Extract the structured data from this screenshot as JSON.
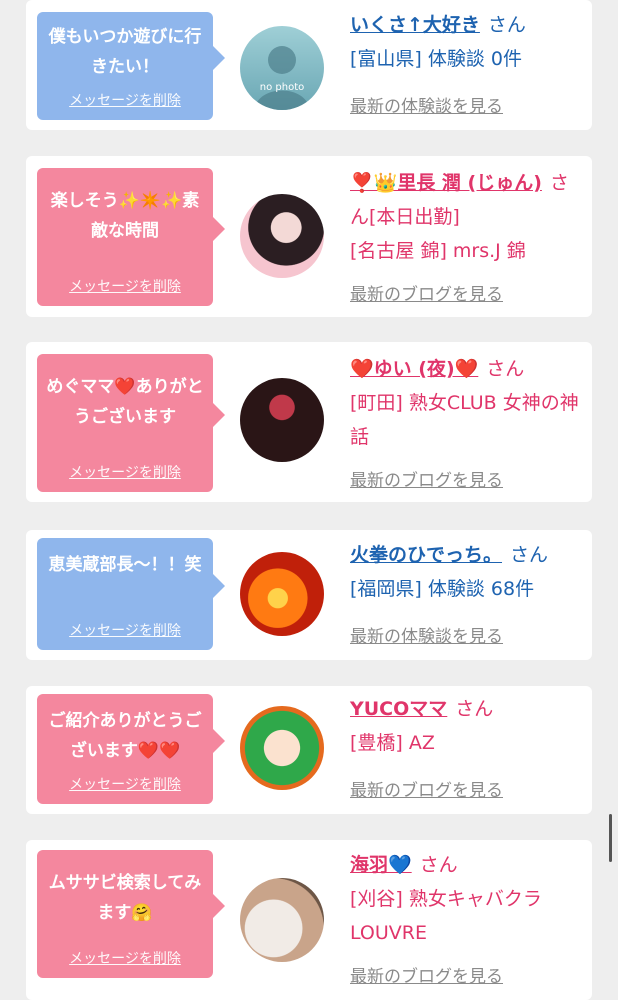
{
  "messages": [
    {
      "bubble_text": "僕もいつか遊びに行きたい！",
      "delete_label": "メッセージを削除",
      "name": "いくさ↑大好き",
      "honorific": "さん",
      "meta": "[富山県] 体験談 0件",
      "see_more": "最新の体験談を見る",
      "avatar_icon": "no-photo-avatar",
      "avatar_text": "no photo"
    },
    {
      "bubble_text": "楽しそう✨✴️✨素敵な時間",
      "delete_label": "メッセージを削除",
      "name": "❣️👑里長 潤 (じゅん)",
      "honorific": "さん",
      "meta_inline": "[本日出勤]",
      "meta": "[名古屋 錦] mrs.J 錦",
      "see_more": "最新のブログを見る",
      "avatar_icon": "user-photo-avatar"
    },
    {
      "bubble_text": "めぐママ❤️ありがとうございます",
      "delete_label": "メッセージを削除",
      "name": "❤️ゆい (夜)❤️",
      "honorific": "さん",
      "meta": "[町田] 熟女CLUB 女神の神話",
      "see_more": "最新のブログを見る",
      "avatar_icon": "user-photo-avatar"
    },
    {
      "bubble_text": "恵美蔵部長〜！！笑",
      "delete_label": "メッセージを削除",
      "name": "火拳のひでっち。",
      "honorific": "さん",
      "meta": "[福岡県] 体験談 68件",
      "see_more": "最新の体験談を見る",
      "avatar_icon": "fire-avatar"
    },
    {
      "bubble_text": "ご紹介ありがとうございます❤️❤️",
      "delete_label": "メッセージを削除",
      "name": "YUCOママ",
      "honorific": "さん",
      "meta": "[豊橋] AZ",
      "see_more": "最新のブログを見る",
      "avatar_icon": "illustration-avatar"
    },
    {
      "bubble_text": "ムササビ検索してみます🤗",
      "delete_label": "メッセージを削除",
      "name": "海羽💙",
      "honorific": "さん",
      "meta": "[刈谷] 熟女キャバクラLOUVRE",
      "see_more": "最新のブログを見る",
      "avatar_icon": "user-photo-avatar"
    }
  ],
  "colors": {
    "blue_bubble": "#8fb6ec",
    "pink_bubble": "#f4879e",
    "blue_text": "#1e63b0",
    "pink_text": "#e0356a"
  }
}
